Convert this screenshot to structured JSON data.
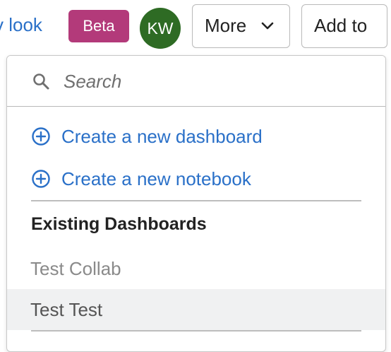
{
  "topbar": {
    "new_look_link": "v look",
    "beta_badge": "Beta",
    "avatar_initials": "KW",
    "more_button": "More",
    "add_to_button": "Add to"
  },
  "dropdown": {
    "search_placeholder": "Search",
    "actions": [
      {
        "label": "Create a new dashboard",
        "icon": "plus-circle-icon"
      },
      {
        "label": "Create a new notebook",
        "icon": "plus-circle-icon"
      }
    ],
    "section_heading": "Existing Dashboards",
    "dashboards": [
      {
        "label": "Test Collab"
      },
      {
        "label": "Test Test",
        "hovered": true
      }
    ]
  },
  "colors": {
    "link_blue": "#2a70c8",
    "beta_magenta": "#b33a7a",
    "avatar_green": "#2e6b24",
    "hover_row": "#f0f1f2"
  }
}
